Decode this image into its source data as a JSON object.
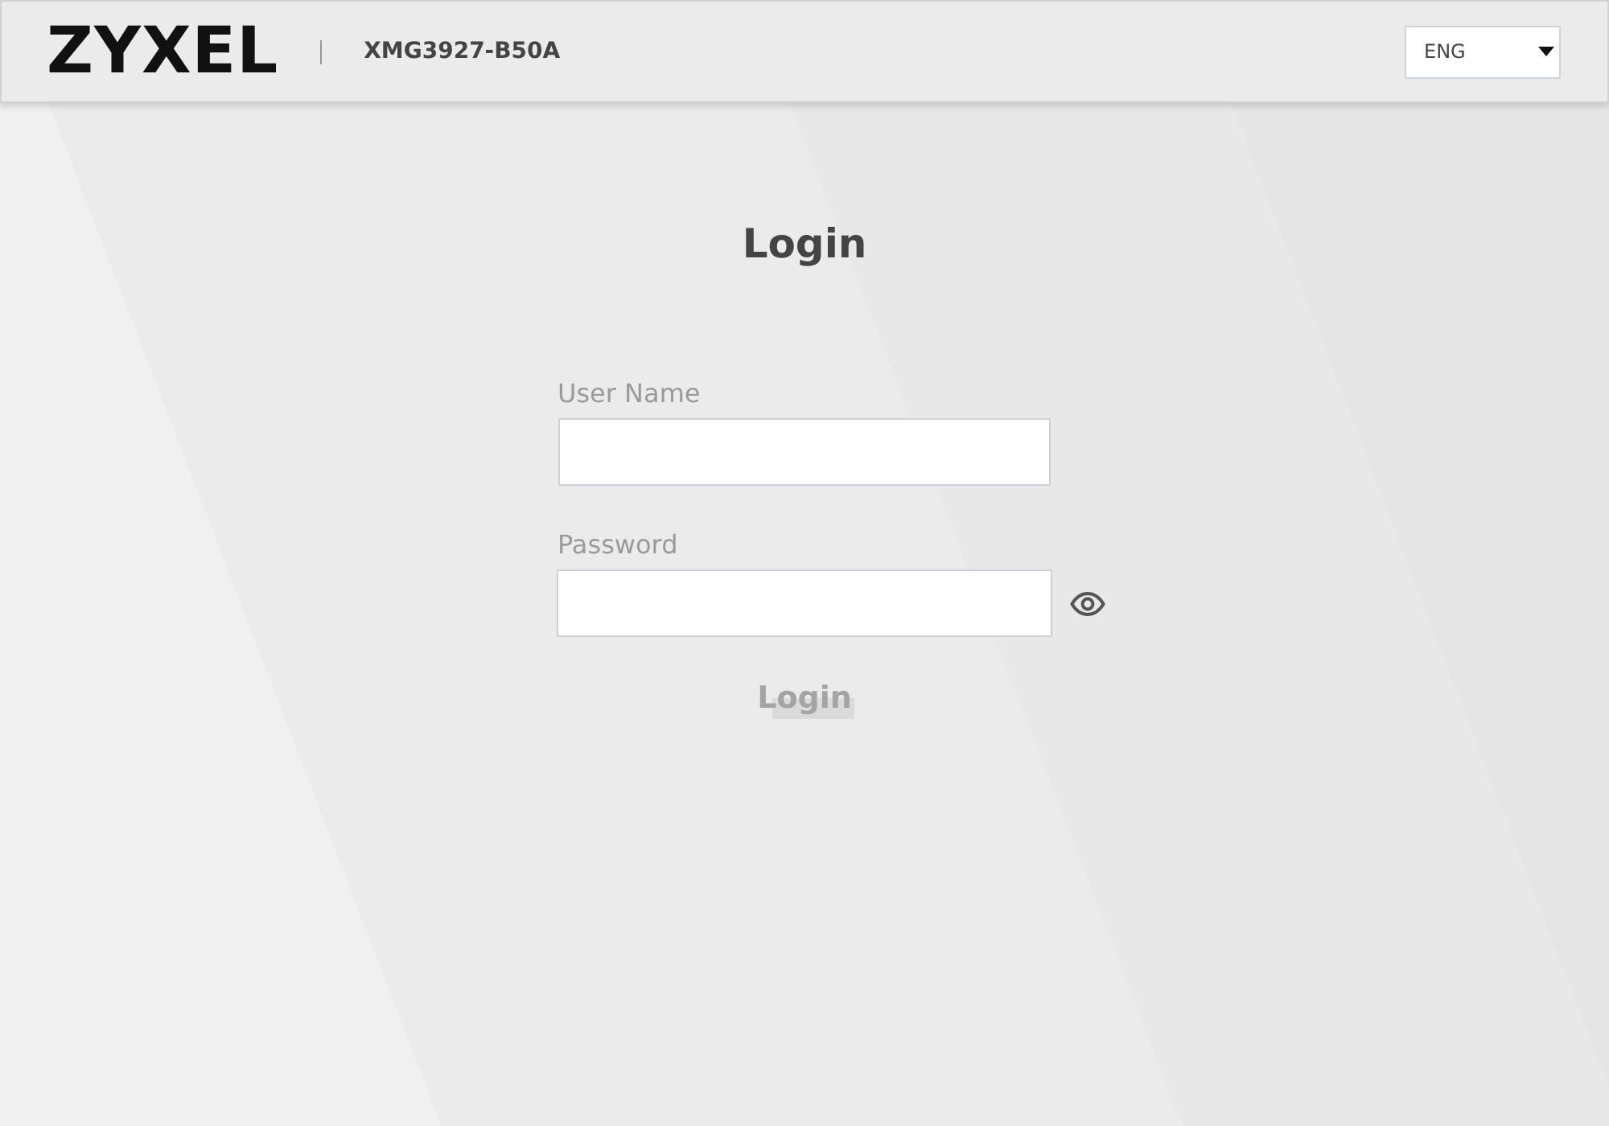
{
  "header": {
    "logo": "ZYXEL",
    "model": "XMG3927-B50A",
    "language": {
      "value": "ENG"
    }
  },
  "login": {
    "title": "Login",
    "fields": [
      {
        "kind": "text",
        "label": "User Name"
      },
      {
        "kind": "password",
        "label": "Password",
        "reveal_toggle": true
      }
    ],
    "button": {
      "label": "Login",
      "disabled": true
    }
  }
}
